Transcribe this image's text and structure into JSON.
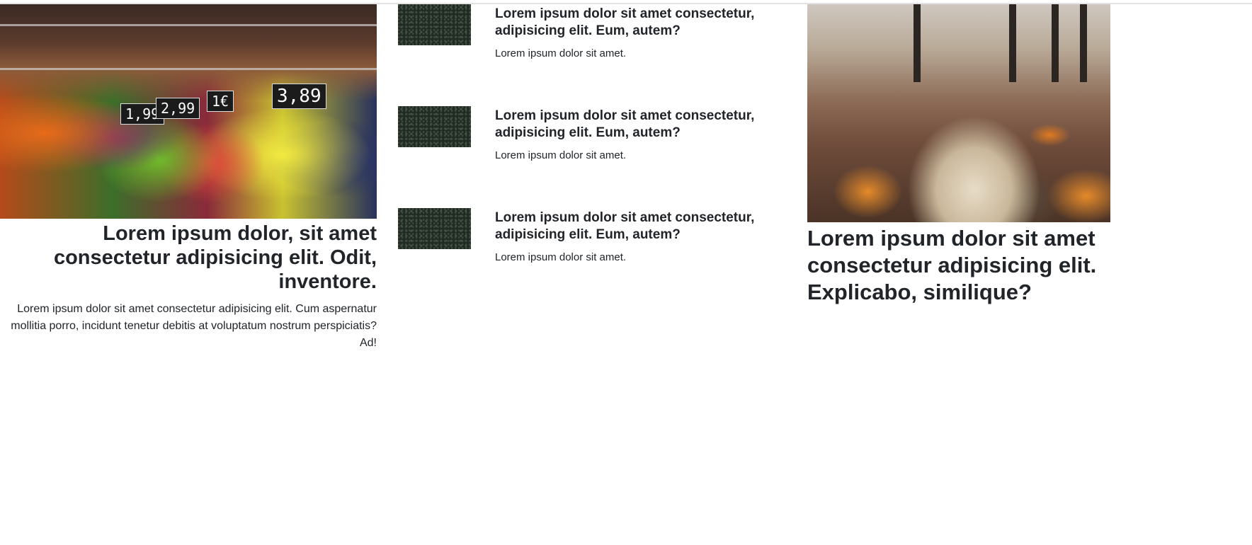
{
  "left_card": {
    "image_alt": "Fruit and vegetable market stall",
    "price_tags": [
      "1,99",
      "2,99",
      "1€",
      "3,89"
    ],
    "title": "Lorem ipsum dolor, sit amet consectetur adipisicing elit. Odit, inventore.",
    "text": "Lorem ipsum dolor sit amet consectetur adipisicing elit. Cum aspernatur mollitia porro, incidunt tenetur debitis at voluptatum nostrum perspiciatis? Ad!"
  },
  "media_list": [
    {
      "title": "Lorem ipsum dolor sit amet consectetur, adipisicing elit. Eum, autem?",
      "text": "Lorem ipsum dolor sit amet."
    },
    {
      "title": "Lorem ipsum dolor sit amet consectetur, adipisicing elit. Eum, autem?",
      "text": "Lorem ipsum dolor sit amet."
    },
    {
      "title": "Lorem ipsum dolor sit amet consectetur, adipisicing elit. Eum, autem?",
      "text": "Lorem ipsum dolor sit amet."
    }
  ],
  "right_card": {
    "image_alt": "Open book with coffee cup and tangerines in autumn forest",
    "title": "Lorem ipsum dolor sit amet consectetur adipisicing elit. Explicabo, similique?"
  },
  "colors": {
    "text": "#212529",
    "background": "#ffffff"
  }
}
